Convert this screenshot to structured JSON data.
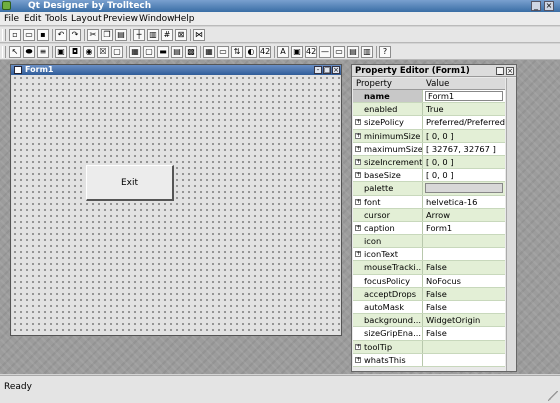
{
  "window": {
    "title": "Qt Designer by Trolltech",
    "accent": "#3a6ea5"
  },
  "menu": [
    "File",
    "Edit",
    "Tools",
    "Layout",
    "Preview",
    "Window",
    "Help"
  ],
  "toolbars": {
    "row1": [
      {
        "icon": "new-file-icon",
        "glyph": "▫"
      },
      {
        "icon": "open-folder-icon",
        "glyph": "▭"
      },
      {
        "icon": "save-icon",
        "glyph": "▪"
      },
      {
        "icon": "undo-icon",
        "glyph": "↶"
      },
      {
        "icon": "redo-icon",
        "glyph": "↷"
      },
      {
        "icon": "cut-icon",
        "glyph": "✂"
      },
      {
        "icon": "copy-icon",
        "glyph": "❐"
      },
      {
        "icon": "paste-icon",
        "glyph": "▤"
      },
      {
        "icon": "layout-horizontal-icon",
        "glyph": "┼"
      },
      {
        "icon": "layout-vertical-icon",
        "glyph": "▥"
      },
      {
        "icon": "layout-grid-icon",
        "glyph": "#"
      },
      {
        "icon": "break-layout-icon",
        "glyph": "⊠"
      },
      {
        "icon": "adjust-size-icon",
        "glyph": "⋈"
      }
    ],
    "row2": [
      {
        "icon": "pointer-icon",
        "glyph": "↖"
      },
      {
        "icon": "connect-icon",
        "glyph": "⬬"
      },
      {
        "icon": "tab-order-icon",
        "glyph": "≡"
      },
      {
        "icon": "push-button-icon",
        "glyph": "▣"
      },
      {
        "icon": "tool-button-icon",
        "glyph": "◘"
      },
      {
        "icon": "radio-button-icon",
        "glyph": "◉"
      },
      {
        "icon": "checkbox-icon",
        "glyph": "☒"
      },
      {
        "icon": "groupbox-icon",
        "glyph": "▢"
      },
      {
        "icon": "frame-icon",
        "glyph": "▦"
      },
      {
        "icon": "widget-stack-icon",
        "glyph": "▢"
      },
      {
        "icon": "tab-widget-icon",
        "glyph": "▬"
      },
      {
        "icon": "listbox-icon",
        "glyph": "▤"
      },
      {
        "icon": "iconview-icon",
        "glyph": "▩"
      },
      {
        "icon": "table-icon",
        "glyph": "▦"
      },
      {
        "icon": "lineedit-icon",
        "glyph": "▭"
      },
      {
        "icon": "spinbox-icon",
        "glyph": "⇅"
      },
      {
        "icon": "dial-icon",
        "glyph": "◐"
      },
      {
        "icon": "lcd-icon",
        "glyph": "42"
      },
      {
        "icon": "label-icon",
        "glyph": "A"
      },
      {
        "icon": "pixmap-label-icon",
        "glyph": "▣"
      },
      {
        "icon": "lcd-number-icon",
        "glyph": "42"
      },
      {
        "icon": "line-icon",
        "glyph": "—"
      },
      {
        "icon": "progressbar-icon",
        "glyph": "▭"
      },
      {
        "icon": "textview-icon",
        "glyph": "▤"
      },
      {
        "icon": "textbrowser-icon",
        "glyph": "▥"
      },
      {
        "icon": "whats-this-icon",
        "glyph": "?"
      }
    ]
  },
  "form": {
    "title": "Form1",
    "exit_button": "Exit"
  },
  "property_editor": {
    "title": "Property Editor (Form1)",
    "headers": {
      "property": "Property",
      "value": "Value"
    },
    "rows": [
      {
        "name": "name",
        "value": "Form1",
        "expand": false,
        "selected": true,
        "box": "text"
      },
      {
        "name": "enabled",
        "value": "True",
        "expand": false
      },
      {
        "name": "sizePolicy",
        "value": "Preferred/Preferred",
        "expand": true
      },
      {
        "name": "minimumSize",
        "value": "[ 0, 0 ]",
        "expand": true
      },
      {
        "name": "maximumSize",
        "value": "[ 32767, 32767 ]",
        "expand": true
      },
      {
        "name": "sizeIncrement",
        "value": "[ 0, 0 ]",
        "expand": true
      },
      {
        "name": "baseSize",
        "value": "[ 0, 0 ]",
        "expand": true
      },
      {
        "name": "palette",
        "value": "",
        "expand": false,
        "box": "palette"
      },
      {
        "name": "font",
        "value": "helvetica-16",
        "expand": true
      },
      {
        "name": "cursor",
        "value": "Arrow",
        "expand": false
      },
      {
        "name": "caption",
        "value": "Form1",
        "expand": true
      },
      {
        "name": "icon",
        "value": "",
        "expand": false
      },
      {
        "name": "iconText",
        "value": "",
        "expand": true
      },
      {
        "name": "mouseTracki...",
        "value": "False",
        "expand": false
      },
      {
        "name": "focusPolicy",
        "value": "NoFocus",
        "expand": false
      },
      {
        "name": "acceptDrops",
        "value": "False",
        "expand": false
      },
      {
        "name": "autoMask",
        "value": "False",
        "expand": false
      },
      {
        "name": "background...",
        "value": "WidgetOrigin",
        "expand": false
      },
      {
        "name": "sizeGripEna...",
        "value": "False",
        "expand": false
      },
      {
        "name": "toolTip",
        "value": "",
        "expand": true
      },
      {
        "name": "whatsThis",
        "value": "",
        "expand": true
      }
    ]
  },
  "status": {
    "text": "Ready"
  }
}
